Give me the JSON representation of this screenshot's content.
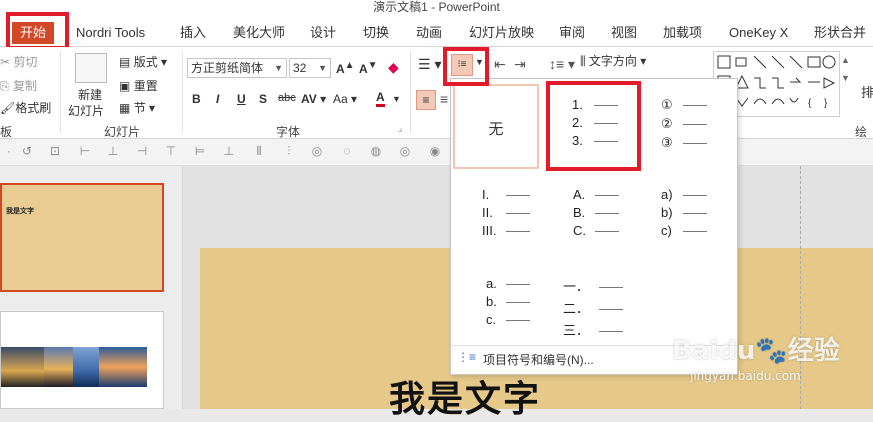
{
  "window": {
    "title": "演示文稿1 - PowerPoint"
  },
  "tabs": [
    "开始",
    "Nordri Tools",
    "插入",
    "美化大师",
    "设计",
    "切换",
    "动画",
    "幻灯片放映",
    "审阅",
    "视图",
    "加载项",
    "OneKey X",
    "形状合并"
  ],
  "ribbon": {
    "clipboard": {
      "cut": "剪切",
      "copy": "复制",
      "format_painter": "格式刷",
      "label": "板"
    },
    "slides": {
      "new_slide_line1": "新建",
      "new_slide_line2": "幻灯片",
      "layout": "版式",
      "reset": "重置",
      "section": "节",
      "label": "幻灯片"
    },
    "font": {
      "font_name": "方正剪纸简体",
      "font_size": "32",
      "bold": "B",
      "italic": "I",
      "underline": "U",
      "shadow": "S",
      "strike": "abc",
      "spacing": "AV",
      "case": "Aa",
      "color": "A",
      "label": "字体"
    },
    "paragraph": {
      "text_direction": "文字方向"
    },
    "drawing": {
      "label": "绘图",
      "arrange": "排"
    }
  },
  "numbering_menu": {
    "none_label": "无",
    "options": [
      [
        "1.",
        "2.",
        "3."
      ],
      [
        "①",
        "②",
        "③"
      ],
      [
        "I.",
        "II.",
        "III."
      ],
      [
        "A.",
        "B.",
        "C."
      ],
      [
        "a)",
        "b)",
        "c)"
      ],
      [
        "a.",
        "b.",
        "c."
      ],
      [
        "一．",
        "二．",
        "三．"
      ]
    ],
    "footer_item": "项目符号和编号(N)..."
  },
  "slides_pane": {
    "slide1_text": "我是文字"
  },
  "canvas": {
    "text": "我是文字"
  },
  "watermark": {
    "brand": "Baidu",
    "brand_cn": "经验",
    "url": "jingyan.baidu.com"
  },
  "colors": {
    "accent": "#d24726",
    "highlight_box": "#e21b2b",
    "parchment": "#e6c889",
    "font_color_bar": "#d0021b"
  }
}
